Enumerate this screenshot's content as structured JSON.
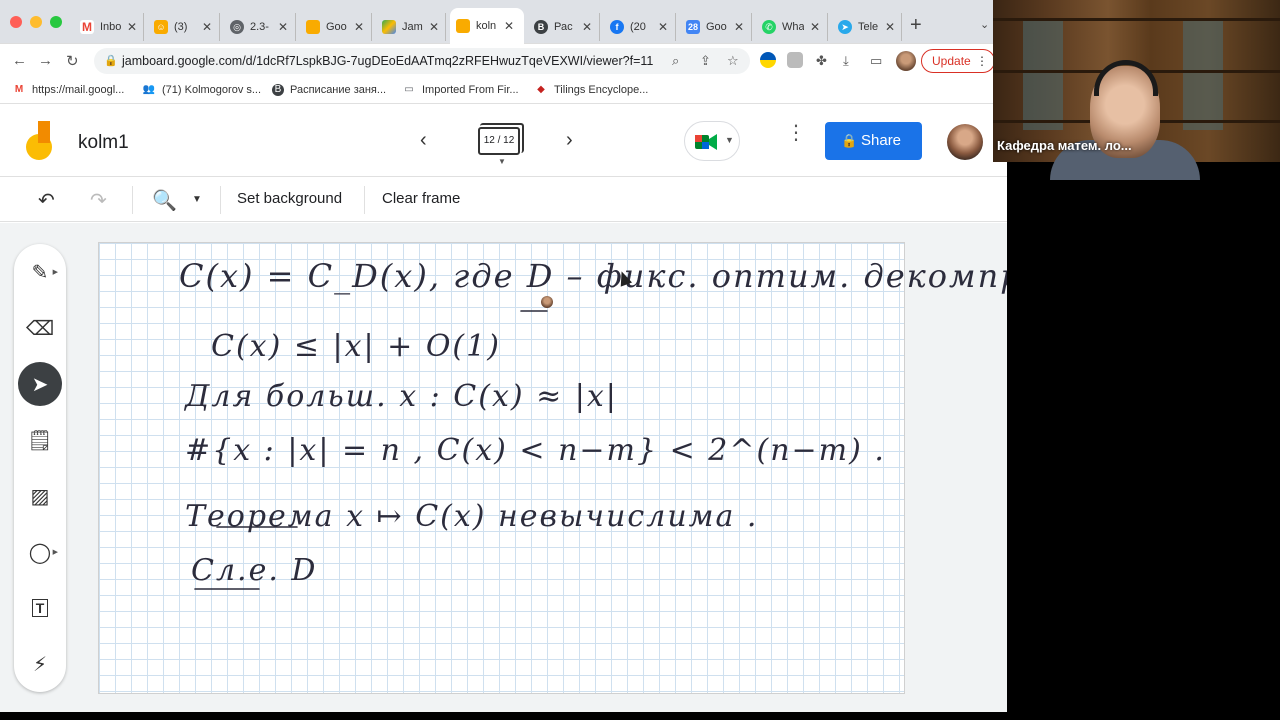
{
  "browser": {
    "tabs": [
      {
        "label": "Inbo",
        "favicon": "gmail-icon",
        "color": "#ea4335"
      },
      {
        "label": "(3)",
        "favicon": "emoji-icon",
        "color": "#f9ab00"
      },
      {
        "label": "2.3-",
        "favicon": "globe-icon",
        "color": "#5f6368"
      },
      {
        "label": "Goo",
        "favicon": "jamboard-icon",
        "color": "#f9ab00"
      },
      {
        "label": "Jam",
        "favicon": "drive-icon",
        "color": "#34a853"
      },
      {
        "label": "koln",
        "favicon": "jamboard-icon",
        "color": "#f9ab00"
      },
      {
        "label": "Рас",
        "favicon": "b-icon",
        "color": "#3c4043"
      },
      {
        "label": "(20",
        "favicon": "facebook-icon",
        "color": "#1877f2"
      },
      {
        "label": "Goo",
        "favicon": "calendar-icon",
        "color": "#4285f4"
      },
      {
        "label": "Wha",
        "favicon": "whatsapp-icon",
        "color": "#25d366"
      },
      {
        "label": "Tele",
        "favicon": "telegram-icon",
        "color": "#29a9eb"
      }
    ],
    "active_tab_index": 5,
    "url": "jamboard.google.com/d/1dcRf7LspkBJG-7ugDEoEdAATmq2zRFEHwuzTqeVEXWI/viewer?f=11",
    "update_label": "Update",
    "bookmarks": [
      {
        "label": "https://mail.googl...",
        "icon": "gmail-icon"
      },
      {
        "label": "(71) Kolmogorov s...",
        "icon": "people-icon"
      },
      {
        "label": "Расписание заня...",
        "icon": "b-icon"
      },
      {
        "label": "Imported From Fir...",
        "icon": "folder-icon"
      },
      {
        "label": "Tilings Encyclope...",
        "icon": "diamond-icon"
      }
    ]
  },
  "app": {
    "title": "kolm1",
    "frame_indicator": "12 / 12",
    "share_label": "Share",
    "brand_blue": "#1a73e8"
  },
  "edit_toolbar": {
    "set_background": "Set background",
    "clear_frame": "Clear frame"
  },
  "side_tools": [
    "pen-icon",
    "eraser-icon",
    "select-icon",
    "sticky-note-icon",
    "image-icon",
    "circle-icon",
    "text-box-icon",
    "laser-icon"
  ],
  "board": {
    "lines": [
      "C(x) = C_D(x), где D – фикс. оптим. декомпр.",
      "C(x) ≤ |x| + O(1)",
      "Для больш. x :   C(x) ≈ |x|",
      "#{x : |x| = n , C(x) < n−m} < 2^(n−m) .",
      "Теорема    x ↦ C(x) невычислима .",
      "Сл.е. D"
    ]
  },
  "video": {
    "participant_name": "Кафедра матем. ло..."
  }
}
